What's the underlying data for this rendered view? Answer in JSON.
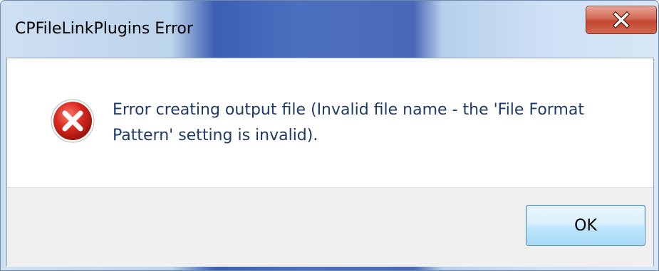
{
  "window": {
    "title": "CPFileLinkPlugins Error",
    "close_icon": "close-icon"
  },
  "dialog": {
    "icon": "error-icon",
    "message": "Error creating output file (Invalid file name - the 'File Format Pattern' setting is invalid).",
    "ok_label": "OK"
  },
  "colors": {
    "close_button": "#c94a35",
    "error_icon": "#c9231a",
    "ok_border": "#3c7fb1",
    "message_text": "#1e3a6a"
  }
}
